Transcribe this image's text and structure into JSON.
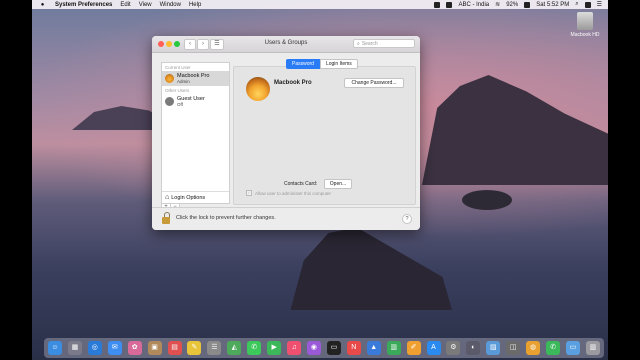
{
  "menubar": {
    "apple": "",
    "items": [
      "System Preferences",
      "Edit",
      "View",
      "Window",
      "Help"
    ],
    "status": {
      "input": "ABC - India",
      "battery": "92%",
      "clock": "Sat 5:52 PM"
    }
  },
  "desktop": {
    "drive_label": "Macbook HD"
  },
  "window": {
    "title": "Users & Groups",
    "nav_back": "‹",
    "nav_forward": "›",
    "grid": "☰",
    "search_placeholder": "Search",
    "search_icon": "⌕",
    "sidebar": {
      "current_header": "Current User",
      "current_user": {
        "name": "Macbook Pro",
        "role": "Admin"
      },
      "other_header": "Other Users",
      "other_user": {
        "name": "Guest User",
        "role": "Off"
      },
      "login_options": "Login Options",
      "add": "+",
      "remove": "−"
    },
    "tabs": [
      "Password",
      "Login Items"
    ],
    "pane": {
      "name": "Macbook Pro",
      "change_password": "Change Password...",
      "contacts_label": "Contacts Card:",
      "open": "Open...",
      "allow_admin": "Allow user to administer this computer"
    },
    "footer": {
      "lock_text": "Click the lock to prevent further changes.",
      "help": "?"
    }
  },
  "dock": {
    "icons": [
      {
        "name": "finder",
        "glyph": "☺",
        "color": "#3a8de0"
      },
      {
        "name": "launchpad",
        "glyph": "▦",
        "color": "#7a7a8a"
      },
      {
        "name": "safari",
        "glyph": "◎",
        "color": "#2a7ad8"
      },
      {
        "name": "mail",
        "glyph": "✉",
        "color": "#3d8ef0"
      },
      {
        "name": "photos",
        "glyph": "✿",
        "color": "#d86a9a"
      },
      {
        "name": "contacts",
        "glyph": "▣",
        "color": "#b08a5a"
      },
      {
        "name": "calendar",
        "glyph": "▤",
        "color": "#e05050"
      },
      {
        "name": "notes",
        "glyph": "✎",
        "color": "#e8c43a"
      },
      {
        "name": "reminders",
        "glyph": "☰",
        "color": "#8a8a8a"
      },
      {
        "name": "maps",
        "glyph": "◭",
        "color": "#4caa5a"
      },
      {
        "name": "messages",
        "glyph": "✆",
        "color": "#3cc85a"
      },
      {
        "name": "facetime",
        "glyph": "▶",
        "color": "#3cb85a"
      },
      {
        "name": "music",
        "glyph": "♫",
        "color": "#f05070"
      },
      {
        "name": "podcasts",
        "glyph": "◉",
        "color": "#9a5ad8"
      },
      {
        "name": "tv",
        "glyph": "▭",
        "color": "#222222"
      },
      {
        "name": "news",
        "glyph": "N",
        "color": "#e84a4a"
      },
      {
        "name": "keynote",
        "glyph": "▲",
        "color": "#3a7ad8"
      },
      {
        "name": "numbers",
        "glyph": "▥",
        "color": "#3aaa5a"
      },
      {
        "name": "pages",
        "glyph": "✐",
        "color": "#f0a030"
      },
      {
        "name": "app-store",
        "glyph": "A",
        "color": "#2a8af0"
      },
      {
        "name": "system-preferences",
        "glyph": "⚙",
        "color": "#7a7a7a"
      },
      {
        "name": "quicktime",
        "glyph": "◐",
        "color": "#5a5a6a"
      },
      {
        "name": "preview",
        "glyph": "▨",
        "color": "#5a9ad8"
      },
      {
        "name": "screenshot",
        "glyph": "◫",
        "color": "#6a6a6a"
      },
      {
        "name": "chrome",
        "glyph": "◍",
        "color": "#e8a030"
      },
      {
        "name": "whatsapp",
        "glyph": "✆",
        "color": "#3ab85a"
      },
      {
        "name": "folder",
        "glyph": "▭",
        "color": "#5aa0e0"
      },
      {
        "name": "trash",
        "glyph": "▥",
        "color": "#9a9aa0"
      }
    ]
  }
}
